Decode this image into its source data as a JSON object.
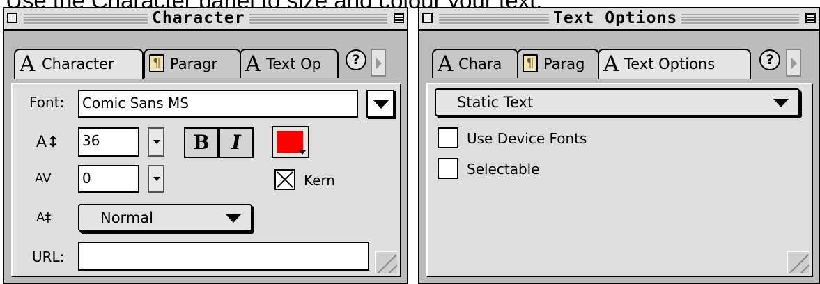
{
  "heading": "Use the Character panel to size and colour your text.",
  "character_panel": {
    "title": "Character",
    "tabs": [
      {
        "label": "Character",
        "icon": "character-glyph-icon"
      },
      {
        "label": "Paragr",
        "icon": "paragraph-icon"
      },
      {
        "label": "Text Op",
        "icon": "text-options-glyph-icon"
      }
    ],
    "help_label": "?",
    "font_label": "Font:",
    "font_value": "Comic Sans MS",
    "size_icon": "A↕",
    "size_value": "36",
    "bold_label": "B",
    "italic_label": "I",
    "text_color": "#ff0000",
    "tracking_icon": "AV",
    "tracking_value": "0",
    "kern_label": "Kern",
    "kern_checked": true,
    "baseline_icon": "A‡",
    "baseline_value": "Normal",
    "url_label": "URL:",
    "url_value": ""
  },
  "text_options_panel": {
    "title": "Text Options",
    "tabs": [
      {
        "label": "Chara",
        "icon": "character-glyph-icon"
      },
      {
        "label": "Parag",
        "icon": "paragraph-icon"
      },
      {
        "label": "Text Options",
        "icon": "text-options-glyph-icon"
      }
    ],
    "help_label": "?",
    "text_type": "Static Text",
    "use_device_fonts_label": "Use Device Fonts",
    "use_device_fonts_checked": false,
    "selectable_label": "Selectable",
    "selectable_checked": false
  }
}
